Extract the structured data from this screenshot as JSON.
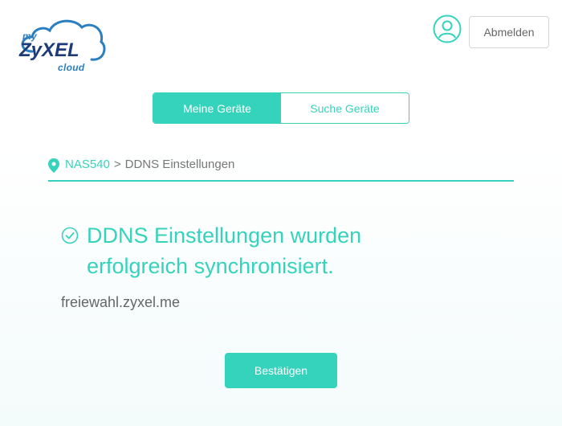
{
  "header": {
    "logo": {
      "prefix": "my",
      "brand": "ZyXEL",
      "suffix": "cloud"
    },
    "user_icon": "user-icon",
    "logout_label": "Abmelden"
  },
  "tabs": [
    {
      "label": "Meine Geräte",
      "active": true
    },
    {
      "label": "Suche Geräte",
      "active": false
    }
  ],
  "breadcrumb": {
    "icon": "location-pin-icon",
    "device": "NAS540",
    "separator": ">",
    "current": "DDNS Einstellungen"
  },
  "message": {
    "icon": "check-circle-icon",
    "text": "DDNS Einstellungen wurden erfolgreich synchronisiert.",
    "domain": "freiewahl.zyxel.me"
  },
  "confirm_label": "Bestätigen",
  "colors": {
    "accent": "#36d3bc",
    "brand_dark": "#1e3a7b",
    "brand_blue": "#2a7fc1"
  }
}
